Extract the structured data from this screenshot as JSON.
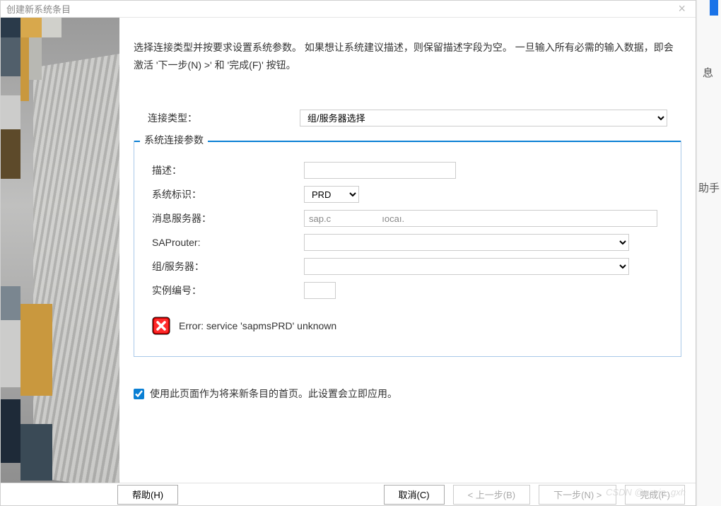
{
  "title": "创建新系统条目",
  "intro": "选择连接类型并按要求设置系统参数。 如果想让系统建议描述，则保留描述字段为空。 一旦输入所有必需的输入数据，即会激活 '下一步(N) >' 和 '完成(F)' 按钮。",
  "labels": {
    "connection_type": "连接类型：",
    "connection_type_value": "组/服务器选择",
    "section": "系统连接参数",
    "description": "描述：",
    "system_id": "系统标识：",
    "system_id_value": "PRD",
    "message_server": "消息服务器：",
    "message_server_value": "sap.c                    ıocaı.",
    "saprouter": "SAProuter:",
    "group_server": "组/服务器：",
    "instance": "实例编号："
  },
  "error": "Error: service 'sapmsPRD' unknown",
  "checkbox": "使用此页面作为将来新条目的首页。此设置会立即应用。",
  "buttons": {
    "help": "帮助(H)",
    "cancel": "取消(C)",
    "back": "< 上一步(B)",
    "next": "下一步(N) >",
    "finish": "完成(F)"
  },
  "sidestrip": {
    "t1": "息",
    "t2": "助手"
  },
  "watermark": "CSDN @gavin_gxh"
}
